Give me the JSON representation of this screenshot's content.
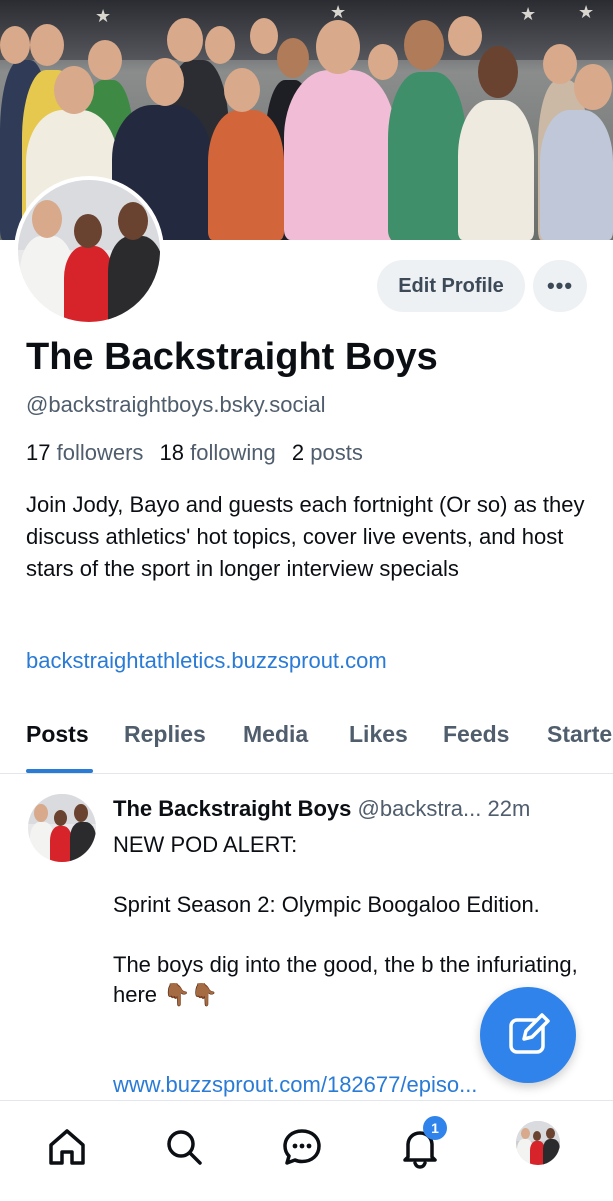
{
  "profile": {
    "display_name": "The Backstraight Boys",
    "handle": "@backstraightboys.bsky.social",
    "followers_count": "17",
    "followers_label": "followers",
    "following_count": "18",
    "following_label": "following",
    "posts_count": "2",
    "posts_label": "posts",
    "bio": "Join Jody, Bayo and guests each fortnight (Or so) as they discuss athletics' hot topics, cover live events, and host stars of the sport in longer interview specials",
    "website": "backstraightathletics.buzzsprout.com"
  },
  "actions": {
    "edit_profile_label": "Edit Profile",
    "more_label": "•••"
  },
  "tabs": [
    {
      "label": "Posts",
      "active": true
    },
    {
      "label": "Replies"
    },
    {
      "label": "Media"
    },
    {
      "label": "Likes"
    },
    {
      "label": "Feeds"
    },
    {
      "label": "Starte"
    }
  ],
  "post": {
    "author_name": "The Backstraight Boys",
    "author_handle": "@backstra...",
    "time": "22m",
    "lines": [
      "NEW POD ALERT:",
      "Sprint Season 2: Olympic Boogaloo Edition.",
      "The boys dig into the good, the b the infuriating, here 👇🏾👇🏾"
    ],
    "link": "www.buzzsprout.com/182677/episo..."
  },
  "nav": {
    "items": [
      "home-icon",
      "search-icon",
      "chat-icon",
      "bell-icon",
      "profile-avatar"
    ],
    "notification_badge": "1"
  },
  "colors": {
    "accent": "#2a7bd6",
    "fab": "#2f83ea",
    "muted_text": "#4f5d6c",
    "button_bg": "#eef1f4"
  }
}
